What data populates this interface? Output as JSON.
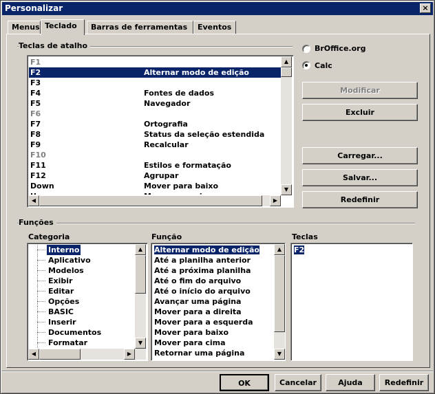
{
  "dialog": {
    "title": "Personalizar",
    "close_glyph": "×"
  },
  "tabs": [
    "Menus",
    "Teclado",
    "Barras de ferramentas",
    "Eventos"
  ],
  "shortcuts": {
    "group_label": "Teclas de atalho",
    "rows": [
      {
        "key": "F1",
        "func": "",
        "disabled": true
      },
      {
        "key": "F2",
        "func": "Alternar modo de edição",
        "selected": true
      },
      {
        "key": "F3",
        "func": ""
      },
      {
        "key": "F4",
        "func": "Fontes de dados"
      },
      {
        "key": "F5",
        "func": "Navegador"
      },
      {
        "key": "F6",
        "func": "",
        "disabled": true
      },
      {
        "key": "F7",
        "func": "Ortografia"
      },
      {
        "key": "F8",
        "func": "Status da seleção estendida"
      },
      {
        "key": "F9",
        "func": "Recalcular"
      },
      {
        "key": "F10",
        "func": "",
        "disabled": true
      },
      {
        "key": "F11",
        "func": "Estilos e formatação"
      },
      {
        "key": "F12",
        "func": "Agrupar"
      },
      {
        "key": "Down",
        "func": "Mover para baixo"
      },
      {
        "key": "Up",
        "func": "Mover para cima"
      }
    ]
  },
  "scope": {
    "option1": "BrOffice.org",
    "option2": "Calc",
    "selected": "Calc"
  },
  "buttons": {
    "modify": "Modificar",
    "delete": "Excluir",
    "load": "Carregar...",
    "save": "Salvar...",
    "reset": "Redefinir"
  },
  "functions": {
    "group_label": "Funções",
    "category_label": "Categoria",
    "function_label": "Função",
    "keys_label": "Teclas",
    "categories": [
      "Interno",
      "Aplicativo",
      "Modelos",
      "Exibir",
      "Editar",
      "Opções",
      "BASIC",
      "Inserir",
      "Documentos",
      "Formatar"
    ],
    "function_list": [
      "Alternar modo de edição",
      "Até a planilha anterior",
      "Até a próxima planilha",
      "Até o fim do arquivo",
      "Até o início do arquivo",
      "Avançar uma página",
      "Mover para a direita",
      "Mover para a esquerda",
      "Mover para baixo",
      "Mover para cima",
      "Retornar uma página"
    ],
    "keys": [
      "F2"
    ]
  },
  "footer": {
    "ok": "OK",
    "cancel": "Cancelar",
    "help": "Ajuda",
    "reset": "Redefinir"
  }
}
